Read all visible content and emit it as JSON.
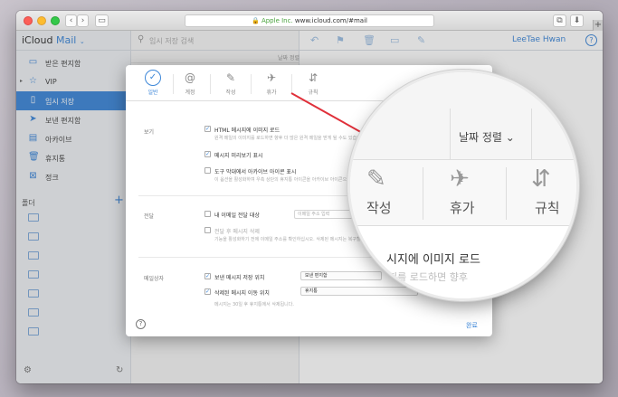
{
  "browser": {
    "url_org": "Apple Inc.",
    "url": "www.icloud.com/#mail",
    "plus": "+"
  },
  "app": {
    "brand_prefix": "iCloud",
    "brand_app": "Mail",
    "search_placeholder": "임시 저장 검색",
    "user_name": "LeeTae Hwan",
    "sort_small": "날짜 정렬"
  },
  "sidebar": {
    "items": [
      {
        "label": "받은 편지함",
        "icon": "inbox-icon"
      },
      {
        "label": "VIP",
        "icon": "star-icon"
      },
      {
        "label": "임시 저장",
        "icon": "draft-icon",
        "selected": true
      },
      {
        "label": "보낸 편지함",
        "icon": "sent-icon"
      },
      {
        "label": "아카이브",
        "icon": "archive-icon"
      },
      {
        "label": "휴지통",
        "icon": "trash-icon"
      },
      {
        "label": "정크",
        "icon": "junk-icon"
      }
    ],
    "folders_header": "폴더"
  },
  "prefs": {
    "tabs": [
      {
        "label": "일반",
        "icon": "check-icon",
        "active": true
      },
      {
        "label": "계정",
        "icon": "at-icon"
      },
      {
        "label": "작성",
        "icon": "compose-icon"
      },
      {
        "label": "휴가",
        "icon": "plane-icon"
      },
      {
        "label": "규칙",
        "icon": "rules-icon"
      }
    ],
    "viewing": {
      "label": "보기",
      "opt1": "HTML 메시지에 이미지 로드",
      "opt1_hint": "원격 메일의 이미지를 로드하면 향후 더 많은 원격 메일을 받게 될 수도 있습니다.",
      "opt2": "메시지 미리보기 표시",
      "opt3": "도구 막대에서 아카이브 아이콘 표시",
      "opt3_hint": "이 옵션을 활성화하여 우측 상단의 휴지통 아이콘을 아카이브 아이콘으로 바꿉니다."
    },
    "forwarding": {
      "label": "전달",
      "opt1": "내 이메일 전달 대상",
      "email_placeholder": "이메일 주소 입력",
      "opt2": "전달 후 메시지 삭제",
      "opt2_hint": "기능을 활성화하기 전에 이메일 주소를 확인하십시오. 삭제된 메시지는 복구할 수 없습니다."
    },
    "mailbox": {
      "label": "메일상자",
      "opt1": "보낸 메시지 저장 위치",
      "opt1_value": "보낸 편지함",
      "opt2": "삭제된 메시지 이동 위치",
      "opt2_value": "휴지통",
      "hint": "메시지는 30일 후 휴지통에서 삭제됩니다."
    },
    "done_label": "완료"
  },
  "magnifier": {
    "sort_label": "날짜 정렬 ⌄",
    "tab1": "작성",
    "tab2": "휴가",
    "tab3": "규칙",
    "line1": "시지에 이미지 로드",
    "line2": "지를 로드하면 향후"
  },
  "colors": {
    "accent": "#3d87d8",
    "arrow": "#e0303a"
  }
}
